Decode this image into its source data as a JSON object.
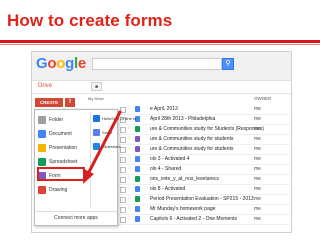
{
  "slide": {
    "title": "How to create forms"
  },
  "google": {
    "logo": [
      "G",
      "o",
      "o",
      "g",
      "l",
      "e"
    ],
    "search_placeholder": "",
    "search_button_icon": "search-icon"
  },
  "drive": {
    "label": "Drive",
    "list_heading": "My Drive",
    "owner_header": "OWNER"
  },
  "create": {
    "label": "CREATE",
    "upload_icon": "upload-icon"
  },
  "menu": {
    "items": [
      {
        "label": "Folder",
        "icon": "folder-icon",
        "color": "#9e9e9e"
      },
      {
        "label": "Document",
        "icon": "document-icon",
        "color": "#4285f4"
      },
      {
        "label": "Presentation",
        "icon": "presentation-icon",
        "color": "#f4b400"
      },
      {
        "label": "Spreadsheet",
        "icon": "spreadsheet-icon",
        "color": "#0f9d58"
      },
      {
        "label": "Form",
        "icon": "form-icon",
        "color": "#7e57c2"
      },
      {
        "label": "Drawing",
        "icon": "drawing-icon",
        "color": "#db4437"
      }
    ],
    "sub_items": [
      {
        "label": "HelloSign  Online si",
        "icon": "hellosign-icon",
        "color": "#1a73e8"
      },
      {
        "label": "Script",
        "icon": "script-icon",
        "color": "#5c7cfa"
      },
      {
        "label": "Slideshare",
        "icon": "slideshare-icon",
        "color": "#1e88e5"
      }
    ],
    "connect_label": "Connect more apps"
  },
  "files": [
    {
      "title": "e April, 2013",
      "owner": "me",
      "color": "#4285f4"
    },
    {
      "title": "April 28th 2013 - Philadelphia",
      "owner": "me",
      "color": "#4285f4"
    },
    {
      "title": "ure & Communities study for Students (Responses)",
      "owner": "me",
      "color": "#0f9d58"
    },
    {
      "title": "ure & Communities study for students",
      "owner": "me",
      "color": "#7e57c2"
    },
    {
      "title": "ure & Communities study for students",
      "owner": "me",
      "color": "#7e57c2"
    },
    {
      "title": "ols 3 - Activated 4",
      "owner": "me",
      "color": "#4285f4"
    },
    {
      "title": "ols 4 - Shared",
      "owner": "me",
      "color": "#4285f4"
    },
    {
      "title": "ons_vote_y_at_nos_lesetarecs",
      "owner": "me",
      "color": "#0f9d58"
    },
    {
      "title": "ols 8 - Activated",
      "owner": "me",
      "color": "#4285f4"
    },
    {
      "title": "Period Presentation Evaluation - SP215 - 2013",
      "owner": "me",
      "color": "#0f9d58"
    },
    {
      "title": "Mr Munday's homework page",
      "owner": "me",
      "color": "#4285f4"
    },
    {
      "title": "Capitols 6 - Activated 2 - One Moments",
      "owner": "me",
      "color": "#4285f4"
    }
  ]
}
